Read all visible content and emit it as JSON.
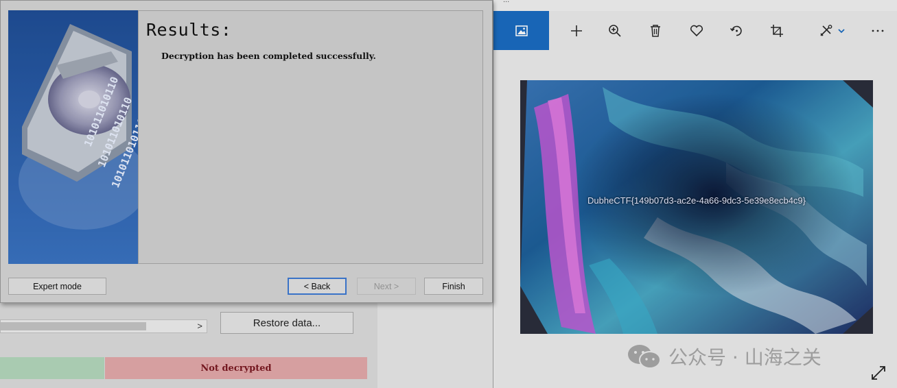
{
  "dialog": {
    "heading": "Results:",
    "message": "Decryption has been completed successfully.",
    "buttons": {
      "expert": "Expert mode",
      "back": "< Back",
      "next": "Next >",
      "finish": "Finish"
    },
    "banner_binary": "101011010110"
  },
  "background_app": {
    "restore_button": "Restore data...",
    "scroll_arrow": ">",
    "status_text": "Not decrypted",
    "status_colors": {
      "ok": "#b4d8bd",
      "fail": "#e4a9ab"
    }
  },
  "photos": {
    "title": "...",
    "toolbar": {
      "icons": [
        "image-icon",
        "add-icon",
        "zoom-in-icon",
        "delete-icon",
        "heart-icon",
        "rotate-icon",
        "crop-icon",
        "edit-icon",
        "more-icon"
      ],
      "accent": "#1a6cc2"
    },
    "image_caption": "DubheCTF{149b07d3-ac2e-4a66-9dc3-5e39e8ecb4c9}",
    "watermark": "公众号 · 山海之关"
  }
}
